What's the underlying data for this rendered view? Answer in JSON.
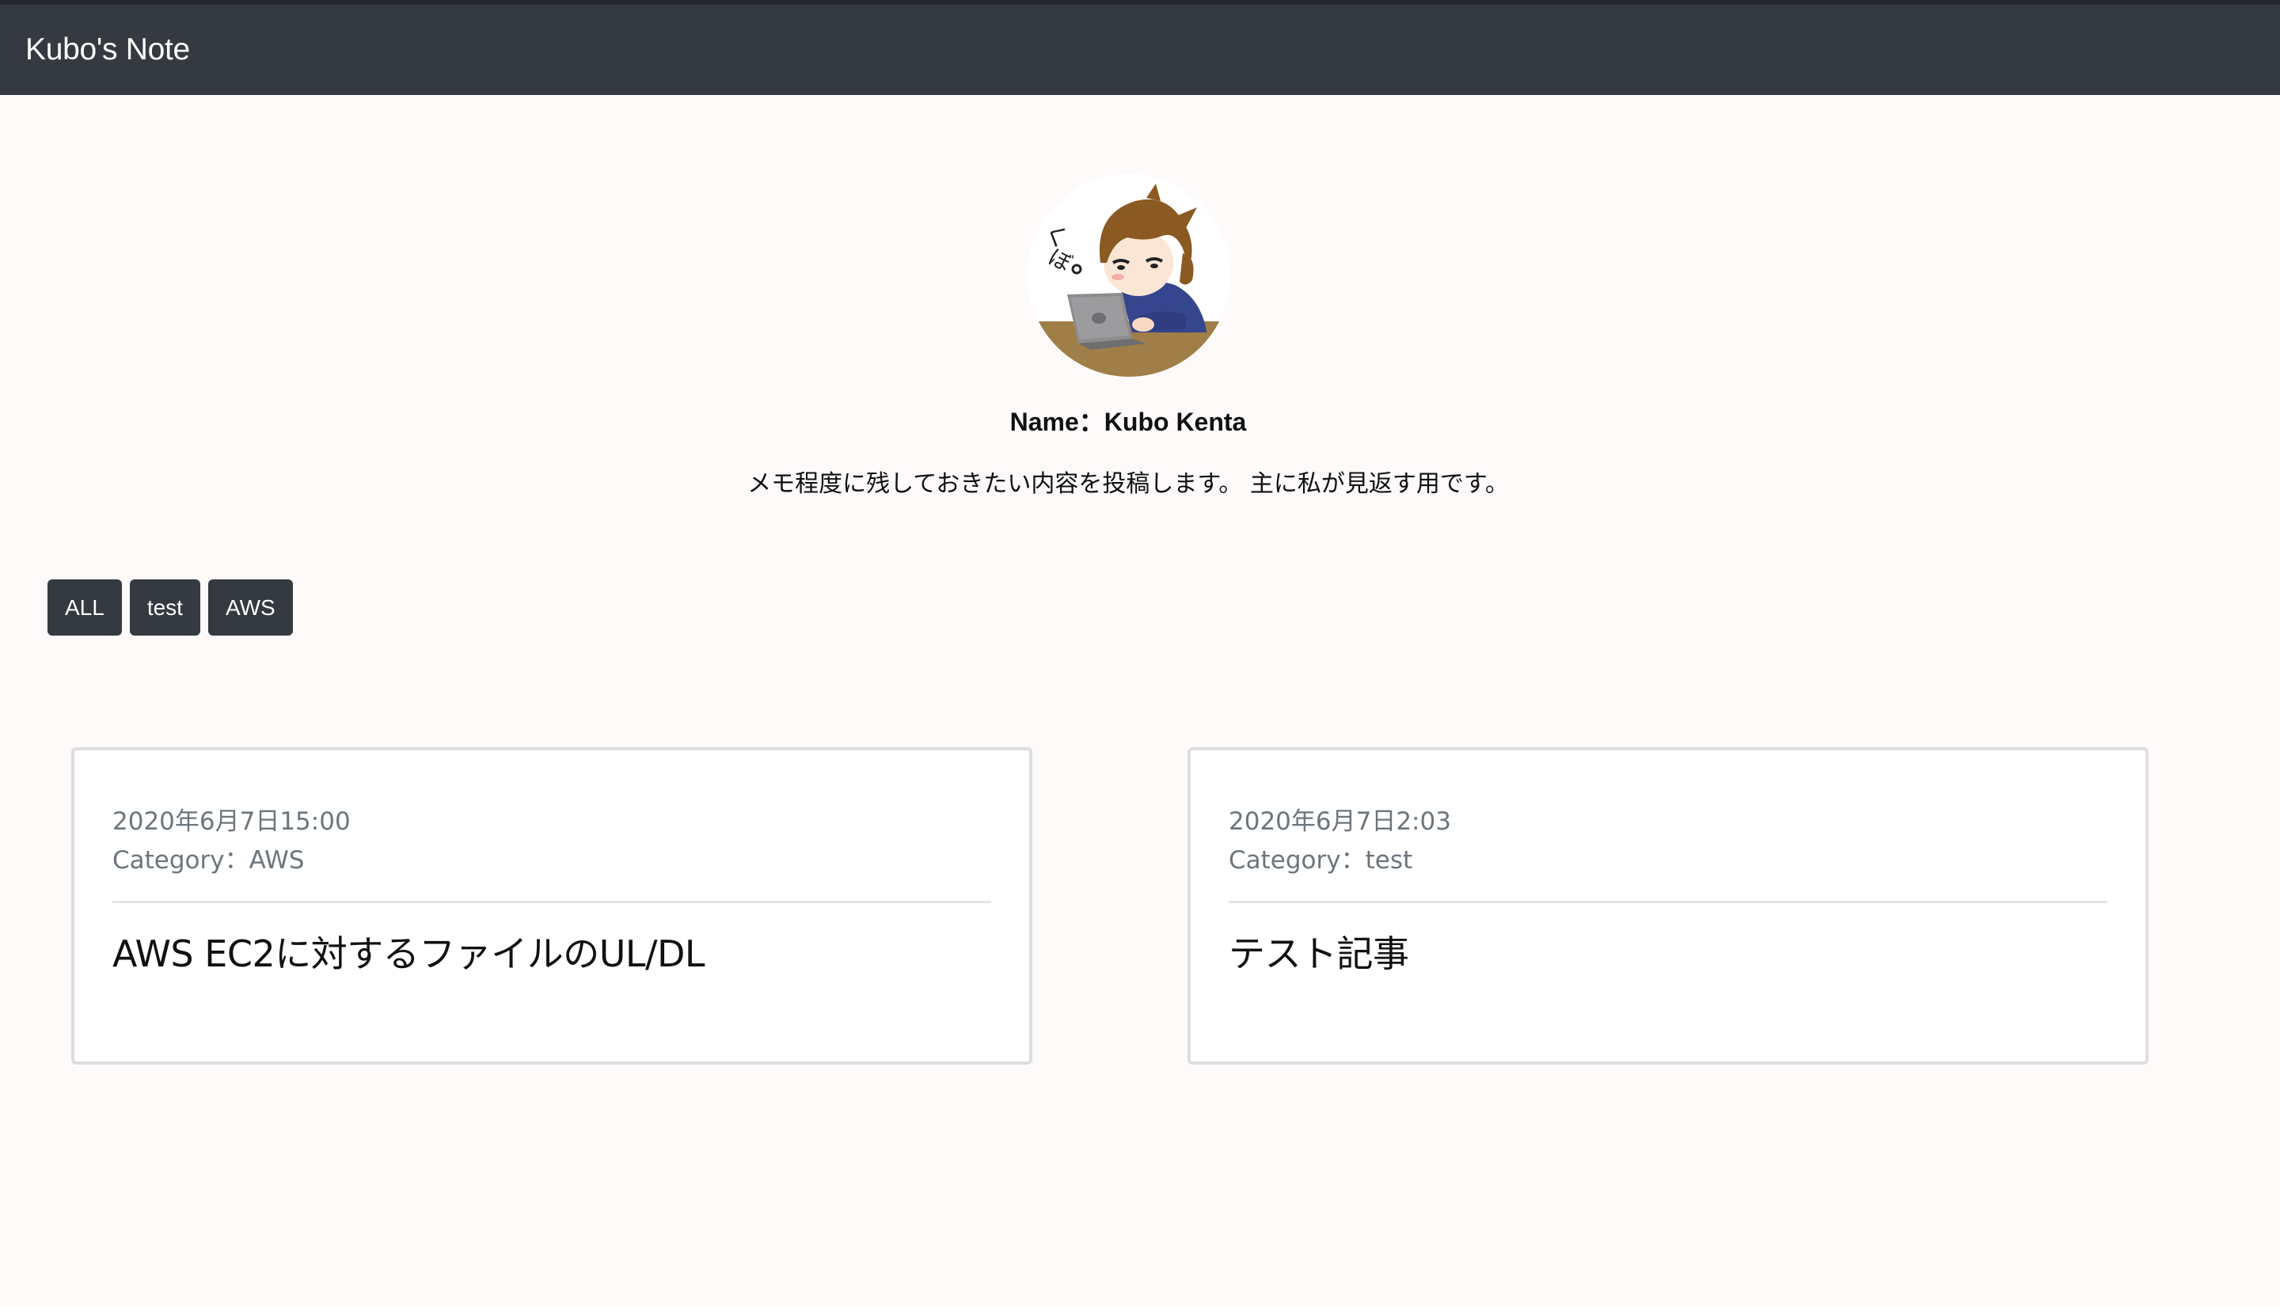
{
  "navbar": {
    "brand": "Kubo's Note"
  },
  "profile": {
    "avatar_icon": "avatar-illustration",
    "name": "Name：Kubo Kenta",
    "description": "メモ程度に残しておきたい内容を投稿します。 主に私が見返す用です。"
  },
  "filters": [
    {
      "label": "ALL"
    },
    {
      "label": "test"
    },
    {
      "label": "AWS"
    }
  ],
  "posts": [
    {
      "date": "2020年6月7日15:00",
      "category": "Category：AWS",
      "title": "AWS EC2に対するファイルのUL/DL"
    },
    {
      "date": "2020年6月7日2:03",
      "category": "Category：test",
      "title": "テスト記事"
    }
  ],
  "colors": {
    "navbar": "#343a40",
    "page_background": "#fdfaf9",
    "button": "#343a40",
    "muted_text": "#6c757d"
  }
}
